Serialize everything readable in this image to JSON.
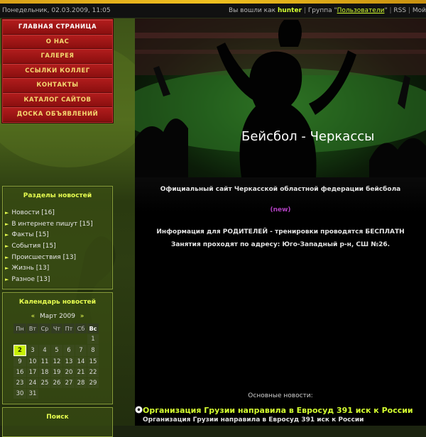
{
  "infobar": {
    "date": "Понедельник, 02.03.2009, 11:05",
    "logged_in_prefix": "Вы вошли как",
    "username": "hunter",
    "group_prefix": "Группа \"",
    "group_name": "Пользователи",
    "group_suffix": "\"",
    "rss": "RSS",
    "my": "Мой"
  },
  "menu": {
    "items": [
      {
        "label": "ГЛАВНАЯ СТРАНИЦА"
      },
      {
        "label": "О НАС"
      },
      {
        "label": "ГАЛЕРЕЯ"
      },
      {
        "label": "ССЫЛКИ КОЛЛЕГ"
      },
      {
        "label": "КОНТАКТЫ"
      },
      {
        "label": "КАТАЛОГ САЙТОВ"
      },
      {
        "label": "ДОСКА ОБЪЯВЛЕНИЙ"
      }
    ]
  },
  "news_sections": {
    "title": "Разделы новостей",
    "items": [
      {
        "label": "Новости",
        "count": "[16]"
      },
      {
        "label": "В интернете пишут",
        "count": "[15]"
      },
      {
        "label": "Факты",
        "count": "[15]"
      },
      {
        "label": "События",
        "count": "[15]"
      },
      {
        "label": "Происшествия",
        "count": "[13]"
      },
      {
        "label": "Жизнь",
        "count": "[13]"
      },
      {
        "label": "Разное",
        "count": "[13]"
      }
    ]
  },
  "calendar": {
    "title": "Календарь новостей",
    "prev": "«",
    "month": "Март 2009",
    "next": "»",
    "weekdays": [
      "Пн",
      "Вт",
      "Ср",
      "Чт",
      "Пт",
      "Сб",
      "Вс"
    ],
    "weeks": [
      [
        "",
        "",
        "",
        "",
        "",
        "",
        "1"
      ],
      [
        "2",
        "3",
        "4",
        "5",
        "6",
        "7",
        "8"
      ],
      [
        "9",
        "10",
        "11",
        "12",
        "13",
        "14",
        "15"
      ],
      [
        "16",
        "17",
        "18",
        "19",
        "20",
        "21",
        "22"
      ],
      [
        "23",
        "24",
        "25",
        "26",
        "27",
        "28",
        "29"
      ],
      [
        "30",
        "31",
        "",
        "",
        "",
        "",
        ""
      ]
    ],
    "today": "2"
  },
  "search": {
    "title": "Поиск"
  },
  "hero": {
    "title": "Бейсбол - Черкассы"
  },
  "content": {
    "tagline": "Официальный сайт Черкасской областной федерации бейсбола",
    "new_badge": "(new)",
    "info1": "Информация для РОДИТЕЛЕЙ - тренировки проводятся БЕСПЛАТН",
    "info2": "Занятия проходят по адресу: Юго-Западный р-н, СШ №26.",
    "news_heading": "Основные новости:",
    "news_title": "Организация Грузии направила в Евросуд 391 иск к России",
    "news_subtitle": "Организация Грузии направила в Евросуд 391 иск к России"
  },
  "colors": {
    "accent": "#d4ff30",
    "menu_red": "#9a1414",
    "panel_green": "#3c5014"
  }
}
